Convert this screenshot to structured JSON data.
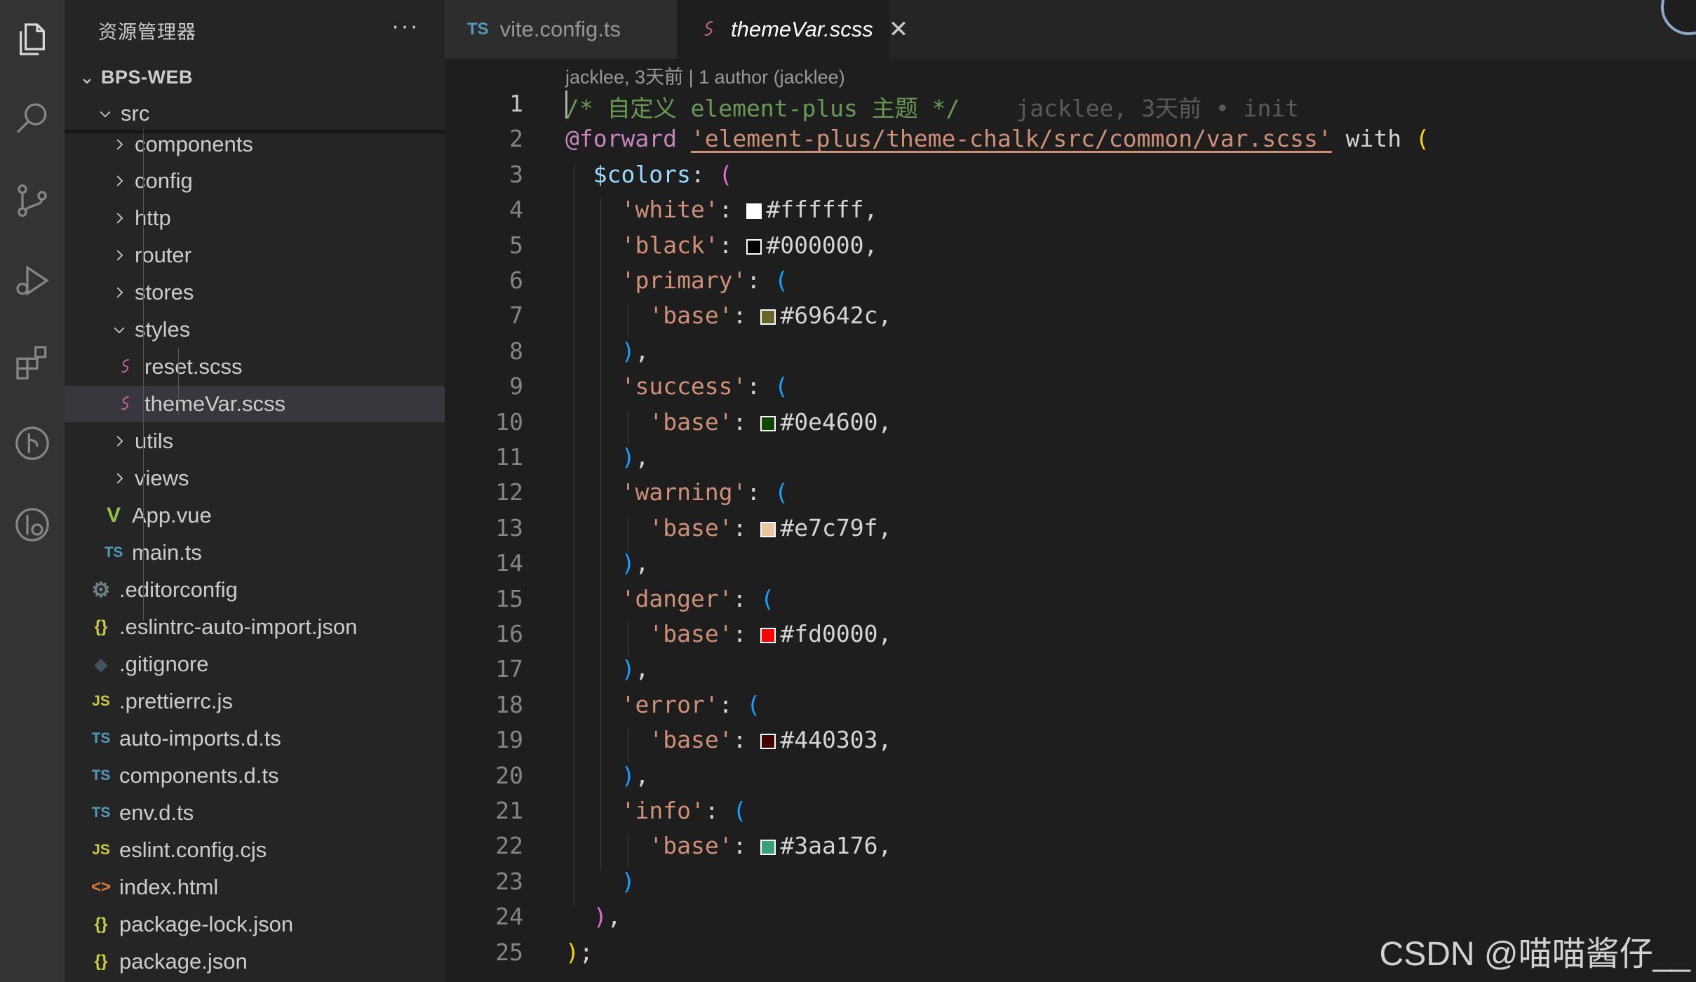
{
  "explorer": {
    "title": "资源管理器",
    "more": "···",
    "project": "BPS-WEB",
    "tree": [
      {
        "name": "src",
        "icon": "folder-open",
        "depth": 0
      },
      {
        "name": "components",
        "icon": "folder",
        "depth": 1
      },
      {
        "name": "config",
        "icon": "folder",
        "depth": 1
      },
      {
        "name": "http",
        "icon": "folder",
        "depth": 1
      },
      {
        "name": "router",
        "icon": "folder",
        "depth": 1
      },
      {
        "name": "stores",
        "icon": "folder",
        "depth": 1
      },
      {
        "name": "styles",
        "icon": "folder-open",
        "depth": 1
      },
      {
        "name": "reset.scss",
        "icon": "sass-icon",
        "depth": 2
      },
      {
        "name": "themeVar.scss",
        "icon": "sass-icon",
        "depth": 2,
        "selected": true
      },
      {
        "name": "utils",
        "icon": "folder",
        "depth": 1
      },
      {
        "name": "views",
        "icon": "folder",
        "depth": 1
      },
      {
        "name": "App.vue",
        "icon": "vue-icon",
        "depth": 1
      },
      {
        "name": "main.ts",
        "icon": "ts-icon",
        "depth": 1
      },
      {
        "name": ".editorconfig",
        "icon": "gear-icon",
        "depth": 0
      },
      {
        "name": ".eslintrc-auto-import.json",
        "icon": "json-icon",
        "depth": 0
      },
      {
        "name": ".gitignore",
        "icon": "git-icon",
        "depth": 0
      },
      {
        "name": ".prettierrc.js",
        "icon": "js-icon",
        "depth": 0
      },
      {
        "name": "auto-imports.d.ts",
        "icon": "ts-icon",
        "depth": 0
      },
      {
        "name": "components.d.ts",
        "icon": "ts-icon",
        "depth": 0
      },
      {
        "name": "env.d.ts",
        "icon": "ts-icon",
        "depth": 0
      },
      {
        "name": "eslint.config.cjs",
        "icon": "js-icon",
        "depth": 0
      },
      {
        "name": "index.html",
        "icon": "html-icon",
        "depth": 0
      },
      {
        "name": "package-lock.json",
        "icon": "json-icon",
        "depth": 0
      },
      {
        "name": "package.json",
        "icon": "json-icon",
        "depth": 0
      }
    ],
    "icon_glyphs": {
      "ts": "TS",
      "js": "JS",
      "json": "{}",
      "html": "<>",
      "vue": "V",
      "gear": "⚙",
      "git": "◆"
    }
  },
  "tabs": [
    {
      "label": "vite.config.ts",
      "badge": "TS",
      "active": false
    },
    {
      "label": "themeVar.scss",
      "active": true,
      "close": "✕"
    }
  ],
  "editor": {
    "codelens": "jacklee, 3天前 | 1 author (jacklee)",
    "blame": "jacklee, 3天前 • init",
    "current_line": 1,
    "lines": [
      {
        "no": "1",
        "comment": "/* 自定义 element-plus 主题 */"
      },
      {
        "no": "2",
        "kw": "@forward",
        "path": "'element-plus/theme-chalk/src/common/var.scss'",
        "with": "with",
        "open": "("
      },
      {
        "no": "3",
        "var": "$colors",
        "colon": ":",
        "open": "("
      },
      {
        "no": "4",
        "key": "'white'",
        "colon": ":",
        "color": "#ffffff",
        "end": ","
      },
      {
        "no": "5",
        "key": "'black'",
        "colon": ":",
        "color": "#000000",
        "end": ","
      },
      {
        "no": "6",
        "key": "'primary'",
        "colon": ":",
        "open": "("
      },
      {
        "no": "7",
        "key": "'base'",
        "colon": ":",
        "color": "#69642c",
        "end": ","
      },
      {
        "no": "8",
        "close": ")",
        "end": ","
      },
      {
        "no": "9",
        "key": "'success'",
        "colon": ":",
        "open": "("
      },
      {
        "no": "10",
        "key": "'base'",
        "colon": ":",
        "color": "#0e4600",
        "end": ","
      },
      {
        "no": "11",
        "close": ")",
        "end": ","
      },
      {
        "no": "12",
        "key": "'warning'",
        "colon": ":",
        "open": "("
      },
      {
        "no": "13",
        "key": "'base'",
        "colon": ":",
        "color": "#e7c79f",
        "end": ","
      },
      {
        "no": "14",
        "close": ")",
        "end": ","
      },
      {
        "no": "15",
        "key": "'danger'",
        "colon": ":",
        "open": "("
      },
      {
        "no": "16",
        "key": "'base'",
        "colon": ":",
        "color": "#fd0000",
        "end": ","
      },
      {
        "no": "17",
        "close": ")",
        "end": ","
      },
      {
        "no": "18",
        "key": "'error'",
        "colon": ":",
        "open": "("
      },
      {
        "no": "19",
        "key": "'base'",
        "colon": ":",
        "color": "#440303",
        "end": ","
      },
      {
        "no": "20",
        "close": ")",
        "end": ","
      },
      {
        "no": "21",
        "key": "'info'",
        "colon": ":",
        "open": "("
      },
      {
        "no": "22",
        "key": "'base'",
        "colon": ":",
        "color": "#3aa176",
        "end": ","
      },
      {
        "no": "23",
        "close": ")"
      },
      {
        "no": "24",
        "close": ")",
        "end": ","
      },
      {
        "no": "25",
        "close": ")",
        "end": ";"
      }
    ]
  },
  "watermark": "CSDN @喵喵酱仔__",
  "colors": {
    "activity_bar": "#333333",
    "sidebar": "#252526",
    "editor": "#1e1e1e",
    "selected_row": "#37373d",
    "sass": "#cd6799",
    "ts": "#519aba",
    "js": "#cbcb41",
    "json": "#cbcb41",
    "vue": "#8dc149",
    "html": "#e37933"
  }
}
